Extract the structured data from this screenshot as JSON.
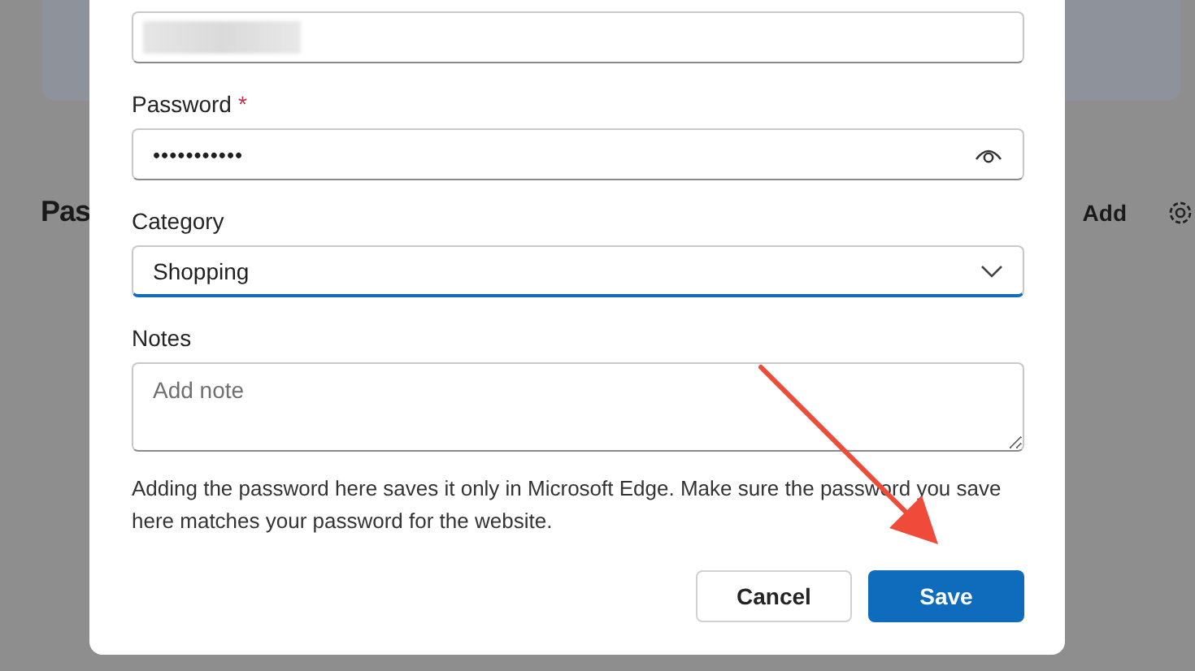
{
  "background": {
    "heading": "Pas",
    "add_link": "Add"
  },
  "dialog": {
    "username_field": {
      "redacted": true
    },
    "password": {
      "label": "Password",
      "required": true,
      "required_mark": "*",
      "value": "•••••••••••"
    },
    "category": {
      "label": "Category",
      "value": "Shopping",
      "focused": true
    },
    "notes": {
      "label": "Notes",
      "placeholder": "Add note"
    },
    "info": "Adding the password here saves it only in Microsoft Edge. Make sure the password you save here matches your password for the website.",
    "buttons": [
      {
        "label": "Cancel",
        "kind": "secondary"
      },
      {
        "label": "Save",
        "kind": "primary"
      }
    ]
  },
  "annotation": {
    "kind": "arrow"
  }
}
